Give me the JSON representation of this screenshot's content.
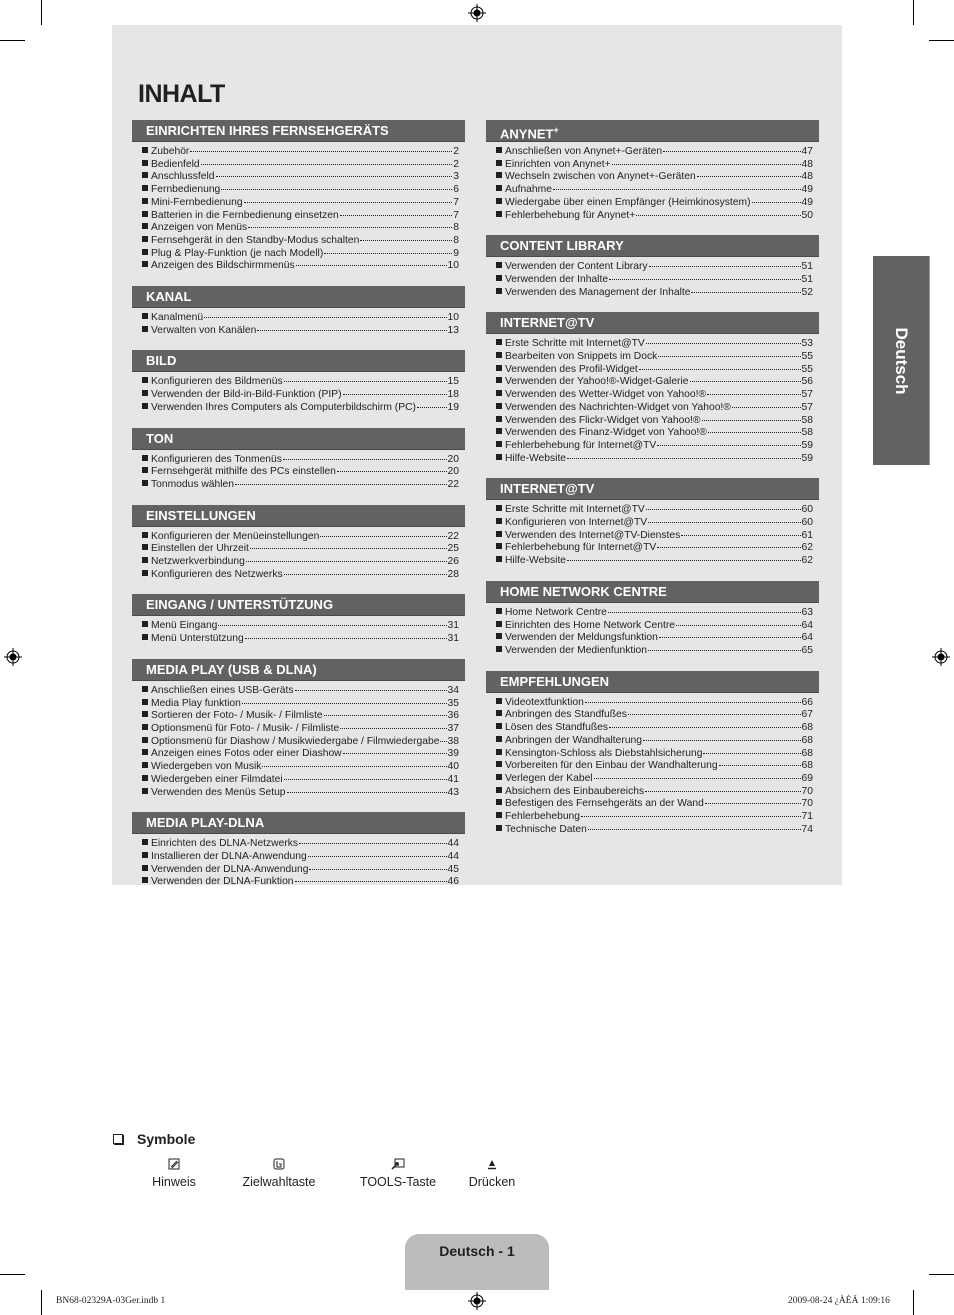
{
  "title": "INHALT",
  "side_tab": "Deutsch",
  "left_column": [
    {
      "heading": "EINRICHTEN IHRES FERNSEHGERÄTS",
      "items": [
        {
          "label": "Zubehör",
          "page": "2"
        },
        {
          "label": "Bedienfeld",
          "page": "2"
        },
        {
          "label": "Anschlussfeld",
          "page": "3"
        },
        {
          "label": "Fernbedienung",
          "page": "6"
        },
        {
          "label": "Mini-Fernbedienung",
          "page": "7"
        },
        {
          "label": "Batterien in die Fernbedienung einsetzen",
          "page": "7"
        },
        {
          "label": "Anzeigen von Menüs",
          "page": "8"
        },
        {
          "label": "Fernsehgerät in den Standby-Modus schalten",
          "page": "8"
        },
        {
          "label": "Plug & Play-Funktion (je nach Modell)",
          "page": "9"
        },
        {
          "label": "Anzeigen des Bildschirmmenüs",
          "page": "10"
        }
      ]
    },
    {
      "heading": "KANAL",
      "items": [
        {
          "label": "Kanalmenü",
          "page": "10"
        },
        {
          "label": "Verwalten von Kanälen",
          "page": "13"
        }
      ]
    },
    {
      "heading": "BILD",
      "items": [
        {
          "label": "Konfigurieren des Bildmenüs",
          "page": "15"
        },
        {
          "label": "Verwenden der Bild-in-Bild-Funktion (PIP)",
          "page": "18"
        },
        {
          "label": "Verwenden Ihres Computers als Computerbildschirm (PC)",
          "page": "19"
        }
      ]
    },
    {
      "heading": "TON",
      "items": [
        {
          "label": "Konfigurieren des Tonmenüs",
          "page": "20"
        },
        {
          "label": "Fernsehgerät mithilfe des PCs einstellen",
          "page": "20"
        },
        {
          "label": "Tonmodus wählen",
          "page": "22"
        }
      ]
    },
    {
      "heading": "EINSTELLUNGEN",
      "items": [
        {
          "label": "Konfigurieren der Menüeinstellungen",
          "page": "22"
        },
        {
          "label": "Einstellen der Uhrzeit",
          "page": "25"
        },
        {
          "label": "Netzwerkverbindung",
          "page": "26"
        },
        {
          "label": "Konfigurieren des Netzwerks",
          "page": "28"
        }
      ]
    },
    {
      "heading": "EINGANG  / UNTERSTÜTZUNG",
      "items": [
        {
          "label": "Menü Eingang",
          "page": "31"
        },
        {
          "label": "Menü Unterstützung",
          "page": "31"
        }
      ]
    },
    {
      "heading": "MEDIA PLAY (USB & DLNA)",
      "items": [
        {
          "label": "Anschließen eines USB-Geräts",
          "page": "34"
        },
        {
          "label": "Media Play funktion",
          "page": "35"
        },
        {
          "label": "Sortieren der Foto- / Musik- / Filmliste",
          "page": "36"
        },
        {
          "label": "Optionsmenü für Foto- / Musik- / Filmliste",
          "page": "37"
        },
        {
          "label": "Optionsmenü für Diashow / Musikwiedergabe / Filmwiedergabe",
          "page": "38"
        },
        {
          "label": "Anzeigen eines Fotos oder einer Diashow",
          "page": "39"
        },
        {
          "label": "Wiedergeben von Musik",
          "page": "40"
        },
        {
          "label": "Wiedergeben einer Filmdatei",
          "page": "41"
        },
        {
          "label": "Verwenden des Menüs Setup",
          "page": "43"
        }
      ]
    },
    {
      "heading": "MEDIA PLAY-DLNA",
      "items": [
        {
          "label": "Einrichten des DLNA-Netzwerks",
          "page": "44"
        },
        {
          "label": "Installieren der DLNA-Anwendung",
          "page": "44"
        },
        {
          "label": "Verwenden der DLNA-Anwendung",
          "page": "45"
        },
        {
          "label": "Verwenden der DLNA-Funktion",
          "page": "46"
        }
      ]
    }
  ],
  "right_column": [
    {
      "heading": "ANYNET",
      "heading_sup": "+",
      "items": [
        {
          "label": "Anschließen von Anynet+-Geräten",
          "page": "47"
        },
        {
          "label": "Einrichten von Anynet+",
          "page": "48"
        },
        {
          "label": "Wechseln zwischen von Anynet+-Geräten",
          "page": "48"
        },
        {
          "label": "Aufnahme",
          "page": "49"
        },
        {
          "label": "Wiedergabe über einen Empfänger (Heimkinosystem)",
          "page": "49"
        },
        {
          "label": "Fehlerbehebung für Anynet+",
          "page": "50"
        }
      ]
    },
    {
      "heading": "CONTENT LIBRARY",
      "items": [
        {
          "label": "Verwenden der Content Library",
          "page": "51"
        },
        {
          "label": "Verwenden der Inhalte",
          "page": "51"
        },
        {
          "label": "Verwenden des Management der Inhalte",
          "page": "52"
        }
      ]
    },
    {
      "heading": "INTERNET@TV",
      "items": [
        {
          "label": "Erste Schritte mit Internet@TV",
          "page": "53"
        },
        {
          "label": "Bearbeiten von Snippets im Dock",
          "page": "55"
        },
        {
          "label": "Verwenden des Profil-Widget",
          "page": "55"
        },
        {
          "label": "Verwenden der Yahoo!®-Widget-Galerie",
          "page": "56"
        },
        {
          "label": "Verwenden des Wetter-Widget von Yahoo!®",
          "page": "57"
        },
        {
          "label": "Verwenden des Nachrichten-Widget von Yahoo!®",
          "page": "57"
        },
        {
          "label": "Verwenden des Flickr-Widget von Yahoo!®",
          "page": "58"
        },
        {
          "label": "Verwenden des Finanz-Widget von Yahoo!®",
          "page": "58"
        },
        {
          "label": "Fehlerbehebung für Internet@TV",
          "page": "59"
        },
        {
          "label": "Hilfe-Website",
          "page": "59"
        }
      ]
    },
    {
      "heading": "INTERNET@TV",
      "items": [
        {
          "label": "Erste Schritte mit Internet@TV",
          "page": "60"
        },
        {
          "label": "Konfigurieren von Internet@TV",
          "page": "60"
        },
        {
          "label": "Verwenden des Internet@TV-Dienstes",
          "page": "61"
        },
        {
          "label": "Fehlerbehebung für Internet@TV",
          "page": "62"
        },
        {
          "label": "Hilfe-Website",
          "page": "62"
        }
      ]
    },
    {
      "heading": "HOME NETWORK CENTRE",
      "items": [
        {
          "label": "Home Network Centre",
          "page": "63"
        },
        {
          "label": "Einrichten des Home Network Centre",
          "page": "64"
        },
        {
          "label": "Verwenden der Meldungsfunktion",
          "page": "64"
        },
        {
          "label": "Verwenden der Medienfunktion",
          "page": "65"
        }
      ]
    },
    {
      "heading": "EMPFEHLUNGEN",
      "items": [
        {
          "label": "Videotextfunktion",
          "page": "66"
        },
        {
          "label": "Anbringen des Standfußes",
          "page": "67"
        },
        {
          "label": "Lösen des Standfußes",
          "page": "68"
        },
        {
          "label": "Anbringen der Wandhalterung",
          "page": "68"
        },
        {
          "label": "Kensington-Schloss als Diebstahlsicherung",
          "page": "68"
        },
        {
          "label": "Vorbereiten für den Einbau der Wandhalterung",
          "page": "68"
        },
        {
          "label": "Verlegen der Kabel",
          "page": "69"
        },
        {
          "label": "Absichern des Einbaubereichs",
          "page": "70"
        },
        {
          "label": "Befestigen des Fernsehgeräts an der Wand",
          "page": "70"
        },
        {
          "label": "Fehlerbehebung",
          "page": "71"
        },
        {
          "label": "Technische Daten",
          "page": "74"
        }
      ]
    }
  ],
  "symbols": {
    "heading": "Symbole",
    "items": [
      {
        "icon": "note-icon",
        "glyph": "🖉",
        "label": "Hinweis"
      },
      {
        "icon": "one-touch-button-icon",
        "glyph": "🖹",
        "label": "Zielwahltaste"
      },
      {
        "icon": "tools-key-icon",
        "glyph": "⬈",
        "label": "TOOLS-Taste"
      },
      {
        "icon": "press-icon",
        "glyph": "▲",
        "label": "Drücken"
      }
    ]
  },
  "page_label": "Deutsch - 1",
  "footer": {
    "file": "BN68-02329A-03Ger.indb   1",
    "timestamp": "2009-08-24   ¿ÀÈÄ 1:09:16"
  },
  "colors": {
    "panel_bg": "#e6e6e6",
    "header_bg": "#636162",
    "page_tab_bg": "#bcbcbc"
  }
}
